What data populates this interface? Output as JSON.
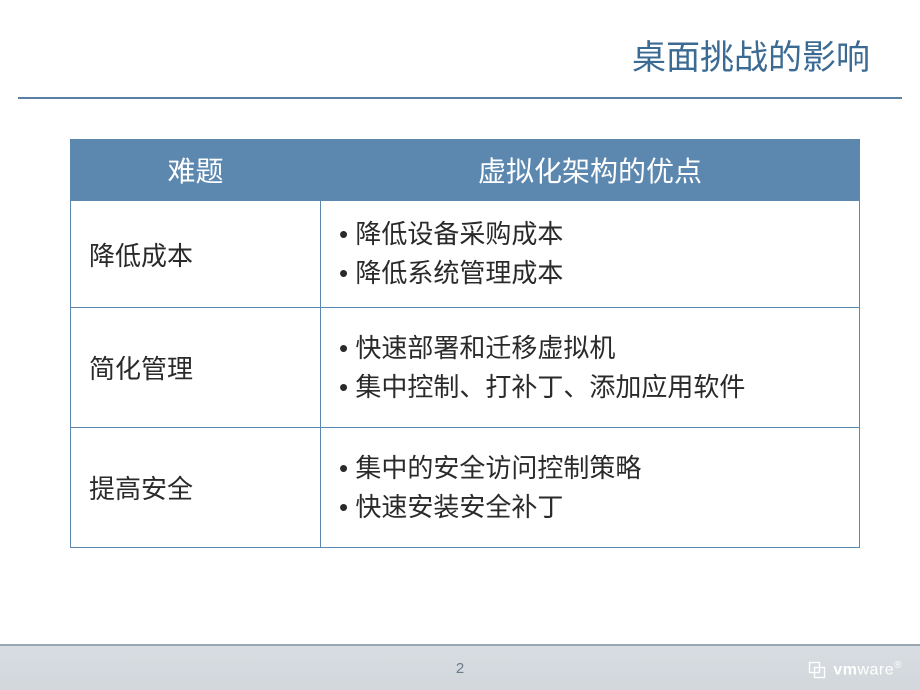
{
  "title": "桌面挑战的影响",
  "table": {
    "headers": [
      "难题",
      "虚拟化架构的优点"
    ],
    "rows": [
      {
        "label": "降低成本",
        "bullets": [
          "• 降低设备采购成本",
          "• 降低系统管理成本"
        ]
      },
      {
        "label": "简化管理",
        "bullets": [
          "• 快速部署和迁移虚拟机",
          "• 集中控制、打补丁、添加应用软件"
        ]
      },
      {
        "label": "提高安全",
        "bullets": [
          "• 集中的安全访问控制策略",
          "• 快速安装安全补丁"
        ]
      }
    ]
  },
  "footer": {
    "page_number": "2",
    "brand_bold": "vm",
    "brand_light": "ware",
    "brand_reg": "®"
  }
}
